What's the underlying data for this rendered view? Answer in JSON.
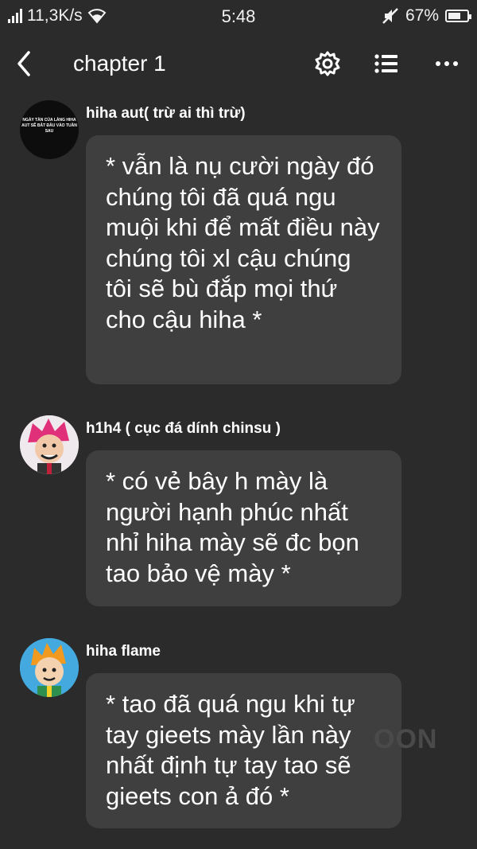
{
  "status_bar": {
    "speed": "11,3K/s",
    "time": "5:48",
    "battery_percent": "67%",
    "battery_level": 0.67
  },
  "header": {
    "title": "chapter 1",
    "icons": [
      "back-icon",
      "gear-icon",
      "list-icon",
      "more-icon"
    ]
  },
  "messages": [
    {
      "author": "hiha aut( trừ ai thì trừ)",
      "avatar_text": "NGÀY TÀN CỦA LÀNG HIHA AUT SẼ BẮT ĐẦU VÀO TUẦN SAU",
      "text": "* vẫn là nụ cười ngày đó chúng tôi đã quá ngu muội khi để mất điều này chúng tôi xl cậu chúng tôi sẽ bù đắp mọi thứ cho cậu hiha *"
    },
    {
      "author": "h1h4 ( cục đá dính chinsu )",
      "text": "* có vẻ bây h mày là người hạnh phúc nhất nhỉ hiha mày sẽ đc bọn tao bảo vệ mày *"
    },
    {
      "author": "hiha flame",
      "text": "* tao đã quá ngu khi tự tay gieets mày lần này nhất định tự tay tao sẽ gieets con ả đó *"
    }
  ],
  "watermark": "OON",
  "colors": {
    "background": "#2b2b2b",
    "bubble": "#3f3f3f",
    "text": "#ffffff"
  }
}
